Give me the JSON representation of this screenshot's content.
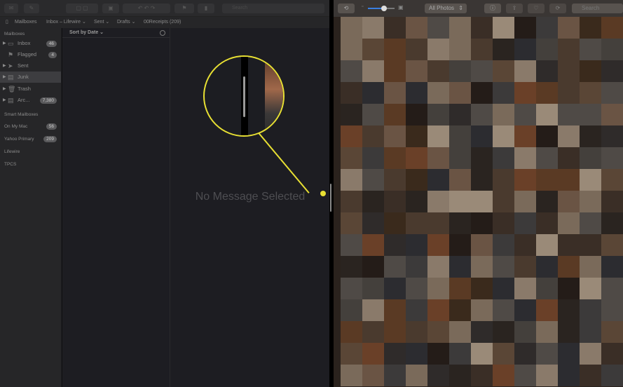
{
  "mail": {
    "toolbar": {
      "search_placeholder": "Search"
    },
    "favorites": {
      "mailboxes": "Mailboxes",
      "inbox": "Inbox – Lifewire ⌄",
      "sent": "Sent ⌄",
      "drafts": "Drafts ⌄",
      "receipts": "00Receipts (209)"
    },
    "sidebar": {
      "section_title": "Mailboxes",
      "items": [
        {
          "label": "Inbox",
          "badge": "46",
          "icon": "inbox-icon"
        },
        {
          "label": "Flagged",
          "badge": "4",
          "icon": "flag-icon"
        },
        {
          "label": "Sent",
          "badge": null,
          "icon": "paper-plane-icon"
        },
        {
          "label": "Junk",
          "badge": null,
          "icon": "junk-icon"
        },
        {
          "label": "Trash",
          "badge": null,
          "icon": "trash-icon"
        },
        {
          "label": "Arc...",
          "badge": "7,380",
          "icon": "archive-icon"
        }
      ],
      "smart_mailboxes": "Smart Mailboxes",
      "accounts": [
        {
          "label": "On My Mac",
          "badge": "56"
        },
        {
          "label": "Yahoo Primary",
          "badge": "209"
        },
        {
          "label": "Lifewire",
          "badge": null
        },
        {
          "label": "TPCS",
          "badge": null
        }
      ]
    },
    "list": {
      "sort_label": "Sort by Date ⌄"
    },
    "viewer": {
      "empty_text": "No Message Selected"
    }
  },
  "photos": {
    "toolbar": {
      "view_select": "All Photos",
      "search_placeholder": "Search",
      "zoom_level": 0.6
    }
  },
  "accent": "#e8e033"
}
